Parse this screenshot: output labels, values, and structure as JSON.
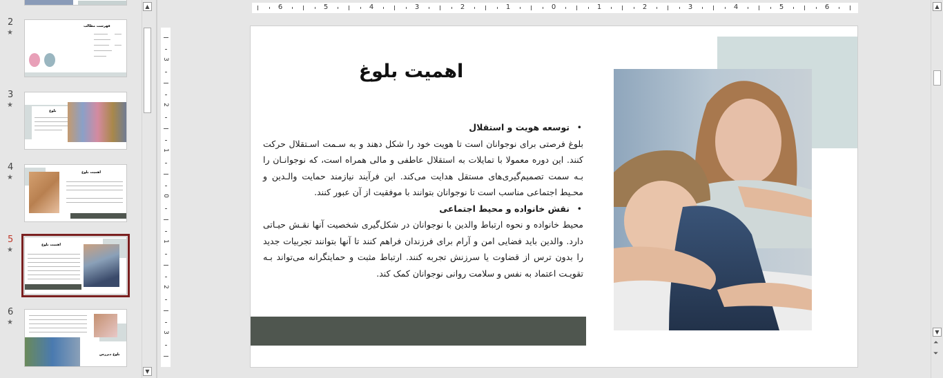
{
  "thumbnails": [
    {
      "number": "2",
      "title": "فهرست مطالب"
    },
    {
      "number": "3",
      "title": "بلوغ"
    },
    {
      "number": "4",
      "title": "اهمیت بلوغ"
    },
    {
      "number": "5",
      "title": "اهمیت بلوغ"
    },
    {
      "number": "6",
      "title": "بلوغ دیررس"
    }
  ],
  "star": "★",
  "ruler": {
    "horizontal": [
      "6",
      "5",
      "4",
      "3",
      "2",
      "1",
      "0",
      "1",
      "2",
      "3",
      "4",
      "5",
      "6"
    ],
    "vertical": [
      "3",
      "2",
      "1",
      "0",
      "1",
      "2",
      "3"
    ]
  },
  "slide": {
    "title": "اهمیت بلوغ",
    "sections": [
      {
        "heading": "توسعه هویت و استقلال",
        "text": "بلوغ فرصتی برای نوجوانان است تا هویت خود را شکل دهند و به سـمت اسـتقلال حرکت کنند. این دوره معمولا با تمایلات به استقلال عاطفی و مالی همراه است، که نوجوانـان را بـه سمت تصمیم‌گیری‌های مستقل هدایت می‌کند. این فرآیند نیازمند حمایت والـدین و محـیط اجتماعی مناسب است تا نوجوانان بتوانند با موفقیت از آن عبور کنند."
      },
      {
        "heading": "نقش خانواده و محیط اجتماعی",
        "text": "محیط خانواده و نحوه ارتباط والدین با نوجوانان در شکل‌گیری شخصیت آنها نقـش حیـاتی دارد. والدین باید فضایی امن و آرام برای فرزندان فراهم کنند تا آنها بتوانند تجربیات جدید را بدون ترس از قضاوت یا سرزنش تجربه کنند. ارتباط مثبت و حمایتگرانه می‌تواند بـه تقویـت اعتماد به نفس و سلامت روانی نوجوانان کمک کند."
      }
    ]
  },
  "colors": {
    "accent": "#d0dddd",
    "bar": "#4f564f",
    "selection": "#7a1f1f"
  }
}
